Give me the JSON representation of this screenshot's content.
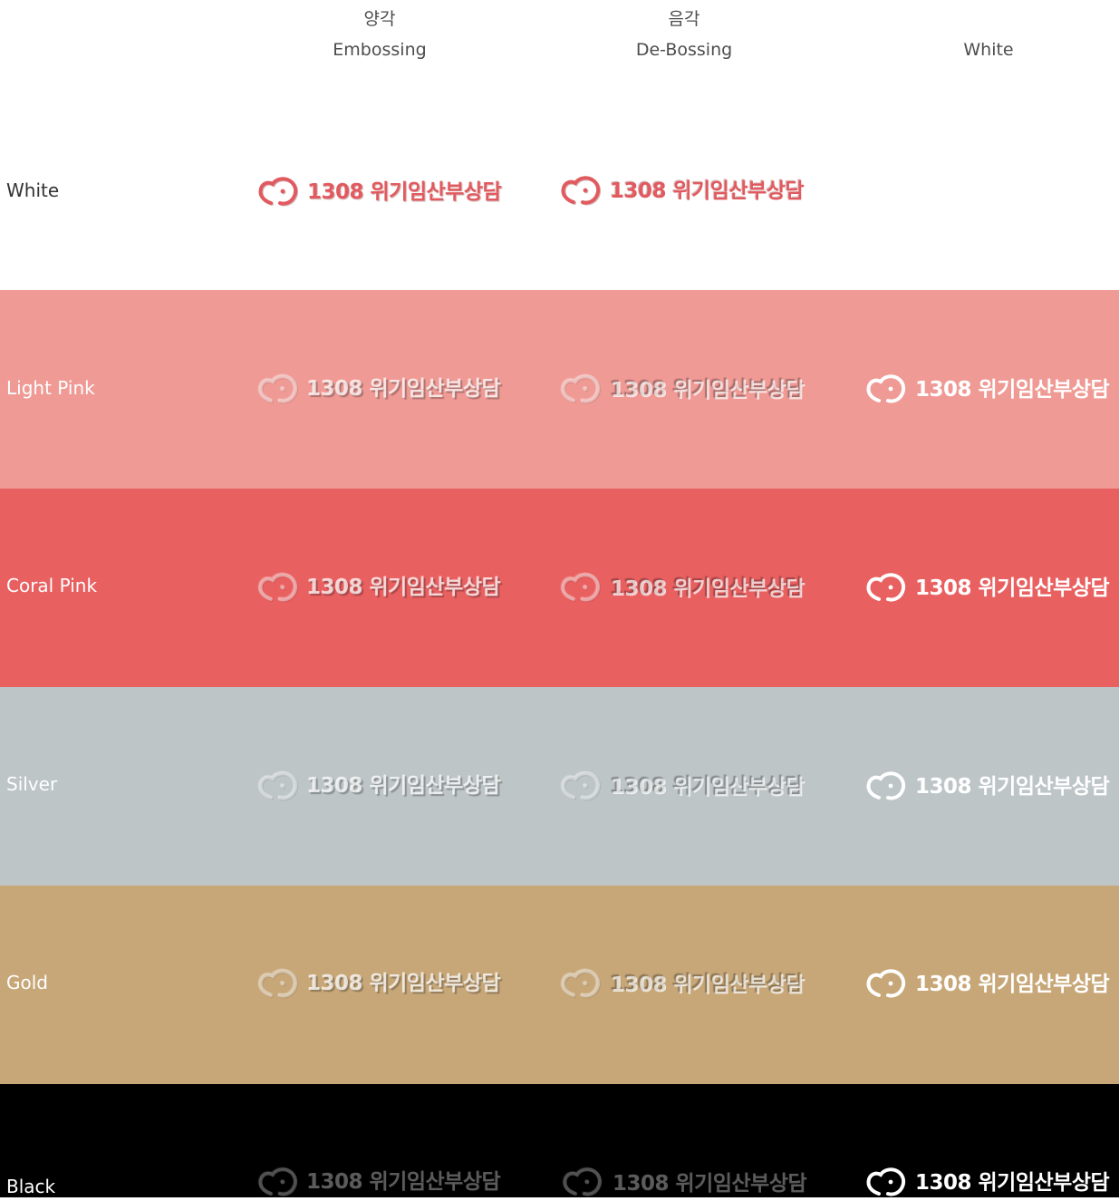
{
  "header": {
    "col1_line1": "양각",
    "col1_line2": "Embossing",
    "col2_line1": "음각",
    "col2_line2": "De-Bossing",
    "col3_line2": "White"
  },
  "logo_text": "1308 위기임산부상담",
  "logo_icon": "heart-face-icon",
  "rows": [
    {
      "label": "White",
      "bg": "#ffffff",
      "label_color": "#333333",
      "logo_accent": "#e05a5f"
    },
    {
      "label": "Light Pink",
      "bg": "#ef9a95",
      "label_color": "#ffffff"
    },
    {
      "label": "Coral Pink",
      "bg": "#e96061",
      "label_color": "#ffffff"
    },
    {
      "label": "Silver",
      "bg": "#bdc5c7",
      "label_color": "#ffffff"
    },
    {
      "label": "Gold",
      "bg": "#c7a778",
      "label_color": "#ffffff"
    },
    {
      "label": "Black",
      "bg": "#000000",
      "label_color": "#ffffff"
    }
  ]
}
